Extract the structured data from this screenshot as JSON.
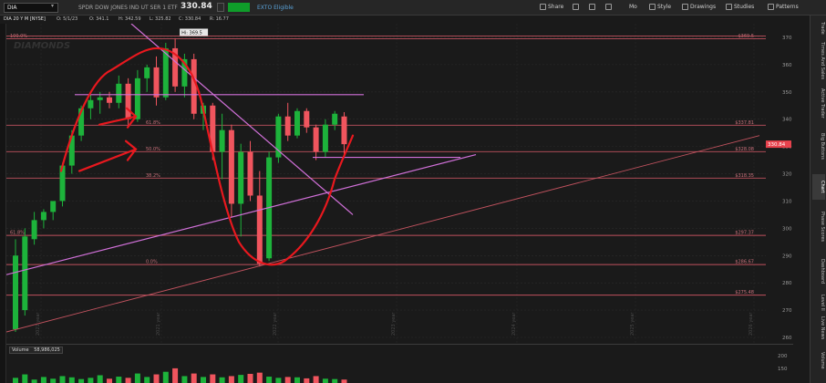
{
  "toolbar": {
    "symbol": "DIA",
    "description": "SPDR DOW JONES IND UT SER 1 ETF",
    "price": "330.84",
    "badge": "EXTO Eligible",
    "buttons": [
      "Share",
      "Mo",
      "Style",
      "Drawings",
      "Studies",
      "Patterns"
    ]
  },
  "subheader": {
    "symbol": "DIA 20 Y M [NYSE]",
    "open": "O: 5/1/23",
    "o_val": "O: 341.1",
    "high": "H: 342.59",
    "low": "L: 325.82",
    "close": "C: 330.84",
    "range": "R: 16.77"
  },
  "watermark": "DIAMONDS",
  "hi_label": "Hi: 369.5",
  "sidebar_tabs": [
    "Trade",
    "Times And Sales",
    "Active Trader",
    "Big Buttons",
    "Chart",
    "Phase Scores",
    "Dashboard",
    "Level II",
    "Live News",
    "Volume"
  ],
  "volume_panel": {
    "label": "Volume",
    "value": "58,986,025",
    "ticks": [
      "200",
      "150"
    ]
  },
  "chart_data": {
    "type": "candlestick",
    "ylim": [
      260,
      373
    ],
    "yticks": [
      260,
      270,
      280,
      290,
      300,
      310,
      320,
      330,
      340,
      350,
      360,
      370
    ],
    "x_labels": [
      "2021 year",
      "2021 year",
      "2022 year",
      "2023 year",
      "2024 year",
      "2025 year",
      "2026 year"
    ],
    "candles": [
      {
        "o": 263,
        "h": 296,
        "l": 262,
        "c": 290
      },
      {
        "o": 270,
        "h": 300,
        "l": 268,
        "c": 297
      },
      {
        "o": 296,
        "h": 306,
        "l": 294,
        "c": 303
      },
      {
        "o": 303,
        "h": 307,
        "l": 300,
        "c": 306
      },
      {
        "o": 306,
        "h": 310,
        "l": 303,
        "c": 310
      },
      {
        "o": 310,
        "h": 324,
        "l": 308,
        "c": 323
      },
      {
        "o": 323,
        "h": 336,
        "l": 320,
        "c": 334
      },
      {
        "o": 334,
        "h": 345,
        "l": 332,
        "c": 344
      },
      {
        "o": 344,
        "h": 349,
        "l": 340,
        "c": 347
      },
      {
        "o": 347,
        "h": 350,
        "l": 342,
        "c": 348
      },
      {
        "o": 348,
        "h": 350,
        "l": 344,
        "c": 346
      },
      {
        "o": 346,
        "h": 356,
        "l": 344,
        "c": 353
      },
      {
        "o": 353,
        "h": 355,
        "l": 338,
        "c": 340
      },
      {
        "o": 340,
        "h": 358,
        "l": 339,
        "c": 355
      },
      {
        "o": 355,
        "h": 360,
        "l": 350,
        "c": 359
      },
      {
        "o": 359,
        "h": 363,
        "l": 345,
        "c": 348
      },
      {
        "o": 348,
        "h": 368,
        "l": 347,
        "c": 366
      },
      {
        "o": 366,
        "h": 369.5,
        "l": 350,
        "c": 352
      },
      {
        "o": 352,
        "h": 364,
        "l": 348,
        "c": 362
      },
      {
        "o": 362,
        "h": 364,
        "l": 340,
        "c": 342
      },
      {
        "o": 342,
        "h": 346,
        "l": 336,
        "c": 345
      },
      {
        "o": 345,
        "h": 346,
        "l": 325,
        "c": 328
      },
      {
        "o": 328,
        "h": 342,
        "l": 318,
        "c": 336
      },
      {
        "o": 336,
        "h": 338,
        "l": 304,
        "c": 309
      },
      {
        "o": 309,
        "h": 331,
        "l": 297,
        "c": 328
      },
      {
        "o": 328,
        "h": 332,
        "l": 310,
        "c": 312
      },
      {
        "o": 312,
        "h": 321,
        "l": 286,
        "c": 287
      },
      {
        "o": 289,
        "h": 328,
        "l": 288,
        "c": 326
      },
      {
        "o": 326,
        "h": 342,
        "l": 324,
        "c": 341
      },
      {
        "o": 341,
        "h": 346,
        "l": 332,
        "c": 334
      },
      {
        "o": 334,
        "h": 344,
        "l": 333,
        "c": 343
      },
      {
        "o": 343,
        "h": 344,
        "l": 335,
        "c": 337
      },
      {
        "o": 337,
        "h": 338,
        "l": 325,
        "c": 328
      },
      {
        "o": 328,
        "h": 340,
        "l": 326,
        "c": 338
      },
      {
        "o": 338,
        "h": 343,
        "l": 336,
        "c": 342
      },
      {
        "o": 341,
        "h": 342.59,
        "l": 325.82,
        "c": 330.84
      }
    ],
    "fib_levels": [
      {
        "label": "100.0%",
        "value": 369.5,
        "right": "$369.5"
      },
      {
        "label": "61.8%",
        "value": 337.8,
        "right": "$337.81"
      },
      {
        "label": "50.0%",
        "value": 328.1,
        "right": "$328.08"
      },
      {
        "label": "38.2%",
        "value": 318.4,
        "right": "$318.35"
      },
      {
        "label": "61.8%",
        "value": 297.4,
        "right": "$297.37"
      },
      {
        "label": "0.0%",
        "value": 286.7,
        "right": "$286.67"
      },
      {
        "label": "",
        "value": 275.5,
        "right": "$275.48"
      }
    ],
    "current_price_label": "330.84",
    "volumes": [
      35,
      55,
      25,
      40,
      30,
      45,
      38,
      28,
      35,
      50,
      30,
      42,
      35,
      60,
      40,
      55,
      70,
      90,
      45,
      60,
      40,
      55,
      38,
      45,
      52,
      58,
      65,
      42,
      35,
      40,
      38,
      32,
      45,
      30,
      28,
      25
    ]
  }
}
